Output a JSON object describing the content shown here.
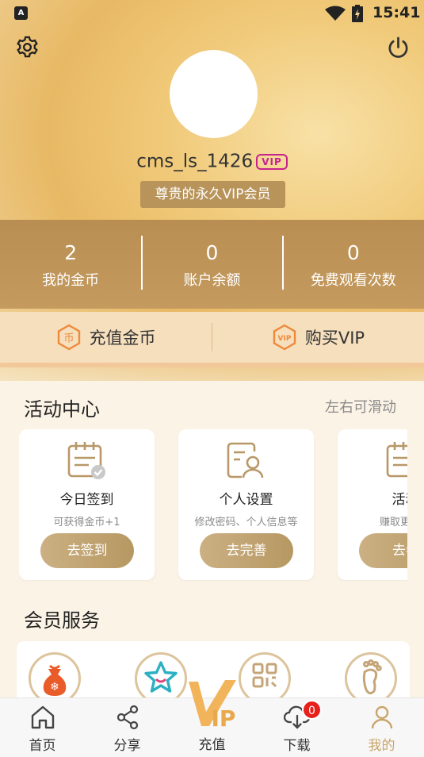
{
  "status_bar": {
    "app_icon_letter": "A",
    "time": "15:41"
  },
  "header": {
    "username": "cms_ls_1426",
    "vip_badge": "VIP",
    "vip_label": "尊贵的永久VIP会员"
  },
  "stats": [
    {
      "value": "2",
      "label": "我的金币"
    },
    {
      "value": "0",
      "label": "账户余额"
    },
    {
      "value": "0",
      "label": "免费观看次数"
    }
  ],
  "recharge": {
    "coins_label": "充值金币",
    "coins_icon_text": "币",
    "vip_label": "购买VIP",
    "vip_icon_text": "VIP"
  },
  "activity": {
    "title": "活动中心",
    "hint": "左右可滑动",
    "cards": [
      {
        "title": "今日签到",
        "subtitle": "可获得金币+1",
        "button": "去签到",
        "icon": "calendar-check-icon"
      },
      {
        "title": "个人设置",
        "subtitle": "修改密码、个人信息等",
        "button": "去完善",
        "icon": "profile-card-icon"
      },
      {
        "title": "活动",
        "subtitle": "赚取更多的",
        "button": "去参",
        "icon": "calendar-list-icon"
      }
    ]
  },
  "services": {
    "title": "会员服务",
    "icons": [
      "gift-bag-icon",
      "star-smile-icon",
      "qr-code-icon",
      "footprint-icon"
    ]
  },
  "tabbar": {
    "items": [
      {
        "label": "首页",
        "icon": "home-icon"
      },
      {
        "label": "分享",
        "icon": "share-icon"
      },
      {
        "label": "充值",
        "icon": "vip-recharge-icon",
        "icon_text": "IP"
      },
      {
        "label": "下载",
        "icon": "download-cloud-icon"
      },
      {
        "label": "我的",
        "icon": "user-icon"
      }
    ],
    "download_badge": "0",
    "active_index": 4
  },
  "colors": {
    "accent_gold": "#c9a56b",
    "stats_band": "#bf9558",
    "vip_badge": "#c7238f",
    "recharge_orange": "#ee8a3c",
    "badge_red": "#e8201c"
  }
}
